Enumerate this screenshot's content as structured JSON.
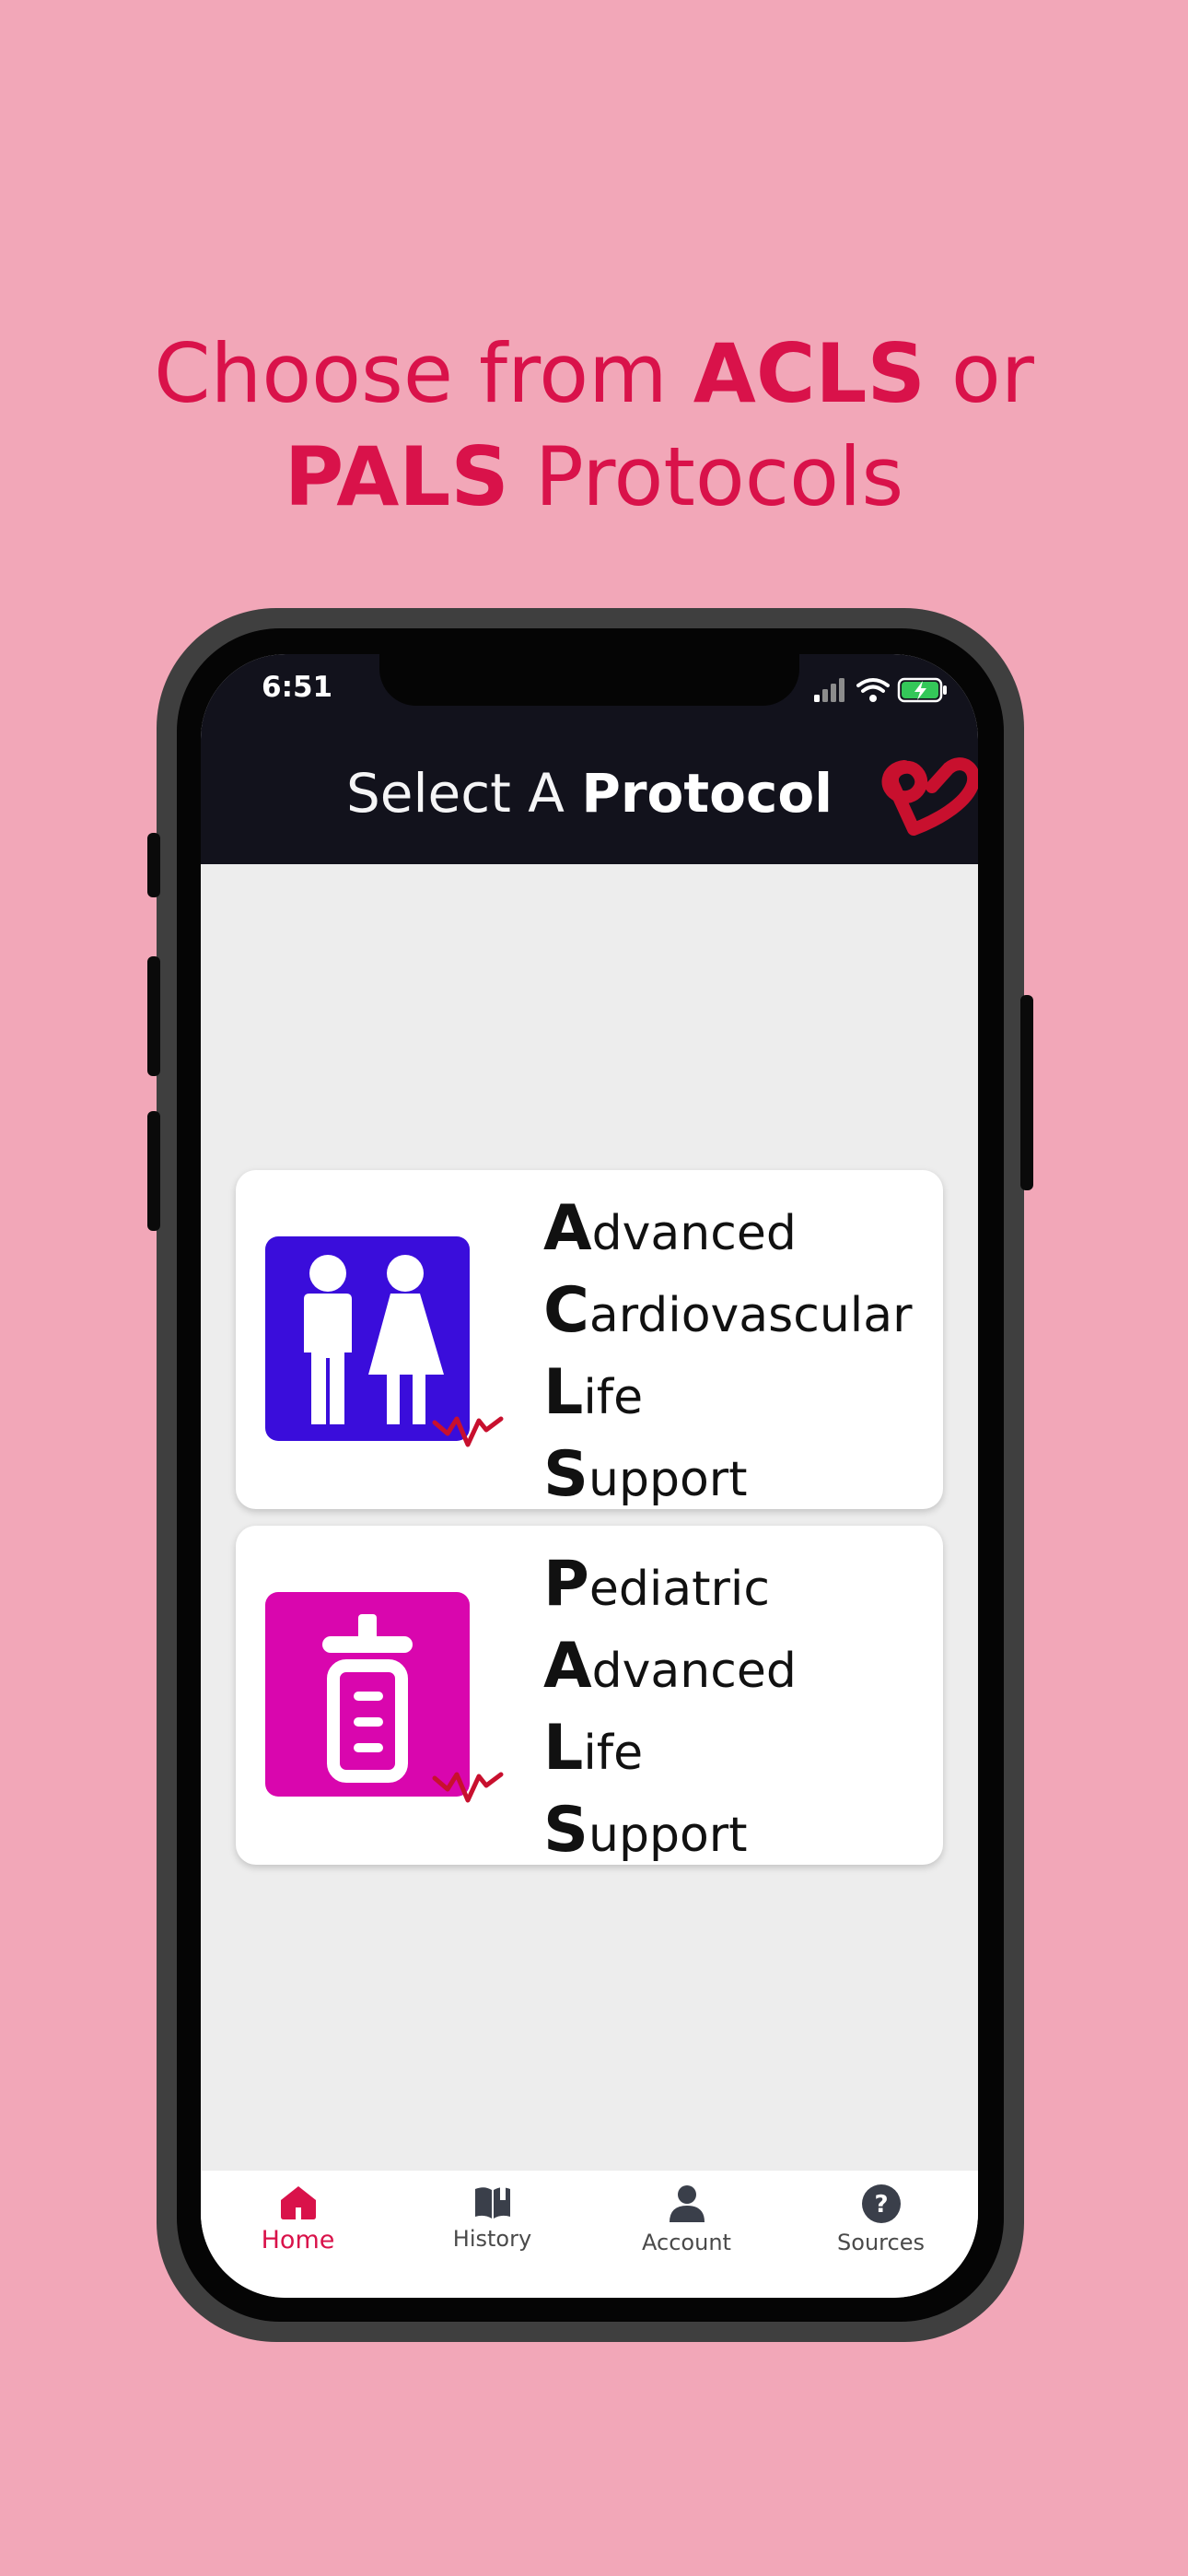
{
  "headline": {
    "line1_pre": "Choose from ",
    "line1_bold": "ACLS",
    "line1_post": " or",
    "line2_bold": "PALS",
    "line2_post": " Protocols"
  },
  "status_bar": {
    "time": "6:51",
    "icons": [
      "signal-icon",
      "wifi-icon",
      "battery-charging-icon"
    ]
  },
  "header": {
    "title_light": "Select A ",
    "title_bold": "Protocol",
    "logo_icon": "brand-heart-logo-icon"
  },
  "protocols": [
    {
      "id": "acls",
      "icon": "adult-figures-icon",
      "icon_bg": "#3A0DDB",
      "rows": [
        {
          "cap": "A",
          "rest": "dvanced"
        },
        {
          "cap": "C",
          "rest": "ardiovascular"
        },
        {
          "cap": "L",
          "rest": "ife"
        },
        {
          "cap": "S",
          "rest": "upport"
        }
      ]
    },
    {
      "id": "pals",
      "icon": "baby-bottle-icon",
      "icon_bg": "#D906AE",
      "rows": [
        {
          "cap": "P",
          "rest": "ediatric"
        },
        {
          "cap": "A",
          "rest": "dvanced"
        },
        {
          "cap": "L",
          "rest": "ife"
        },
        {
          "cap": "S",
          "rest": "upport"
        }
      ]
    }
  ],
  "tabbar": {
    "tabs": [
      {
        "label": "Home",
        "icon": "home-icon",
        "active": true
      },
      {
        "label": "History",
        "icon": "book-icon",
        "active": false
      },
      {
        "label": "Account",
        "icon": "person-icon",
        "active": false
      },
      {
        "label": "Sources",
        "icon": "question-circle-icon",
        "active": false
      }
    ]
  },
  "colors": {
    "background": "#F2A7B8",
    "accent": "#D9124A",
    "header_bg": "#12121C",
    "screen_bg": "#EDEDED"
  }
}
